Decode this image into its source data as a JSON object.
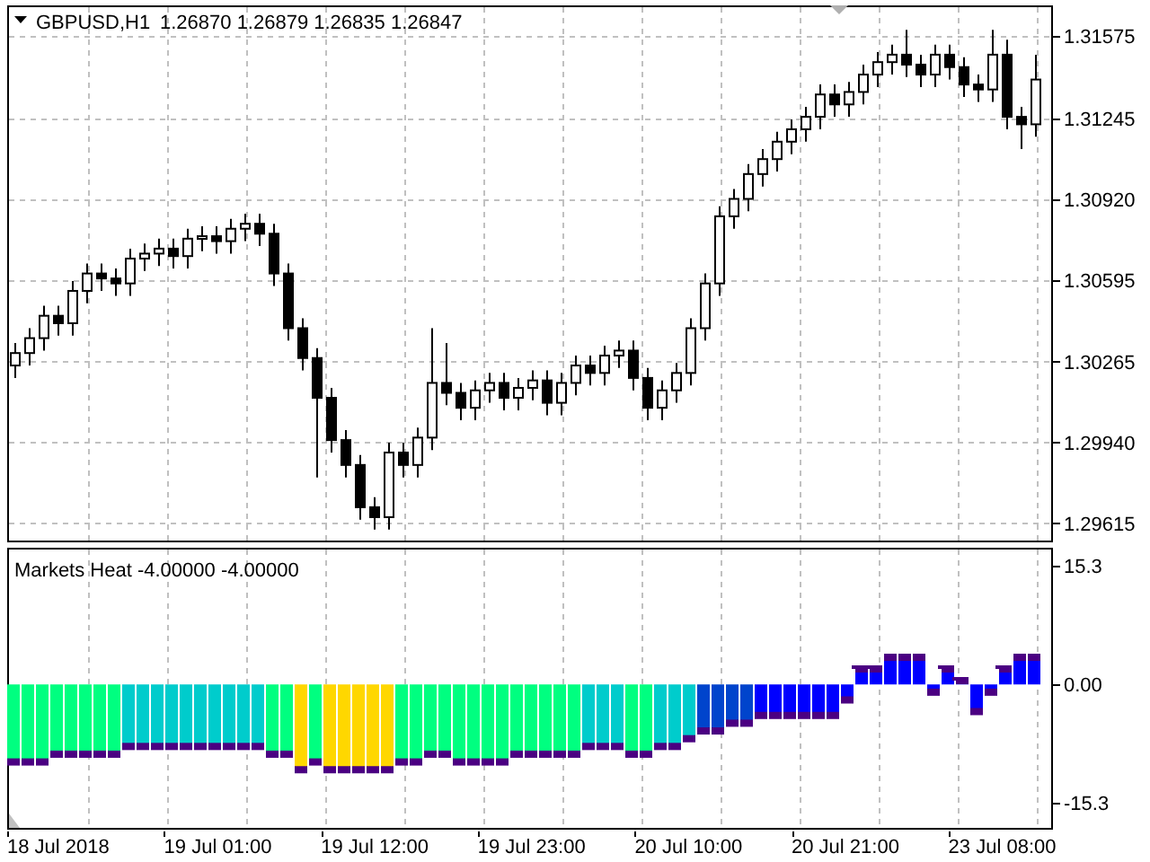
{
  "chart": {
    "symbol": "GBPUSD,H1",
    "quotes": "1.26870 1.26879 1.26835 1.26847",
    "chart_data": {
      "type": "candlestick",
      "grid": true,
      "categories": [
        null,
        null,
        null,
        null,
        null,
        null,
        null,
        null,
        null,
        null,
        null,
        null,
        null,
        null,
        null,
        null,
        null,
        null,
        null,
        null,
        null,
        null,
        null,
        null,
        null,
        null,
        null,
        null,
        null,
        null,
        null,
        null,
        null,
        null,
        null,
        null,
        null,
        null,
        null,
        null,
        null,
        null,
        null,
        null,
        null,
        null,
        null,
        null,
        null,
        null,
        null,
        null,
        null,
        null,
        null,
        null,
        null,
        null,
        null,
        null,
        null,
        null,
        null,
        null,
        null,
        null,
        null,
        null,
        null,
        null,
        null,
        null
      ],
      "ohlc": [
        [
          1.3025,
          1.3034,
          1.302,
          1.303
        ],
        [
          1.303,
          1.304,
          1.3025,
          1.3036
        ],
        [
          1.3036,
          1.3049,
          1.3031,
          1.3045
        ],
        [
          1.3045,
          1.3049,
          1.3037,
          1.3042
        ],
        [
          1.3042,
          1.3059,
          1.3037,
          1.3055
        ],
        [
          1.3055,
          1.3066,
          1.305,
          1.3062
        ],
        [
          1.3062,
          1.3066,
          1.3055,
          1.306
        ],
        [
          1.306,
          1.3064,
          1.3053,
          1.3058
        ],
        [
          1.3058,
          1.3072,
          1.3053,
          1.3068
        ],
        [
          1.3068,
          1.3074,
          1.3063,
          1.307
        ],
        [
          1.307,
          1.3076,
          1.3065,
          1.3072
        ],
        [
          1.3072,
          1.3076,
          1.3064,
          1.3069
        ],
        [
          1.3069,
          1.308,
          1.3064,
          1.3076
        ],
        [
          1.3076,
          1.3081,
          1.3071,
          1.3077
        ],
        [
          1.3077,
          1.3081,
          1.307,
          1.3075
        ],
        [
          1.3075,
          1.3084,
          1.307,
          1.308
        ],
        [
          1.308,
          1.3086,
          1.3075,
          1.3082
        ],
        [
          1.3082,
          1.3086,
          1.3073,
          1.3078
        ],
        [
          1.3078,
          1.3082,
          1.3057,
          1.3062
        ],
        [
          1.3062,
          1.3066,
          1.3035,
          1.304
        ],
        [
          1.304,
          1.3044,
          1.3023,
          1.3028
        ],
        [
          1.3028,
          1.3032,
          1.298,
          1.3012
        ],
        [
          1.3012,
          1.3016,
          1.299,
          1.2995
        ],
        [
          1.2995,
          1.2999,
          1.298,
          1.2985
        ],
        [
          1.2985,
          1.2989,
          1.2963,
          1.2968
        ],
        [
          1.2968,
          1.2972,
          1.2959,
          1.2964
        ],
        [
          1.2964,
          1.2994,
          1.2959,
          1.299
        ],
        [
          1.299,
          1.2994,
          1.298,
          1.2985
        ],
        [
          1.2985,
          1.3,
          1.298,
          1.2996
        ],
        [
          1.2996,
          1.304,
          1.2991,
          1.3018
        ],
        [
          1.3018,
          1.3034,
          1.3009,
          1.3014
        ],
        [
          1.3014,
          1.3018,
          1.3003,
          1.3008
        ],
        [
          1.3008,
          1.3019,
          1.3003,
          1.3015
        ],
        [
          1.3015,
          1.3022,
          1.301,
          1.3018
        ],
        [
          1.3018,
          1.3022,
          1.3007,
          1.3012
        ],
        [
          1.3012,
          1.302,
          1.3007,
          1.3016
        ],
        [
          1.3016,
          1.3023,
          1.3011,
          1.3019
        ],
        [
          1.3019,
          1.3023,
          1.3005,
          1.301
        ],
        [
          1.301,
          1.3022,
          1.3005,
          1.3018
        ],
        [
          1.3018,
          1.3029,
          1.3013,
          1.3025
        ],
        [
          1.3025,
          1.3029,
          1.3017,
          1.3022
        ],
        [
          1.3022,
          1.3033,
          1.3017,
          1.3029
        ],
        [
          1.3029,
          1.3035,
          1.3024,
          1.3031
        ],
        [
          1.3031,
          1.3035,
          1.3015,
          1.302
        ],
        [
          1.302,
          1.3024,
          1.3003,
          1.3008
        ],
        [
          1.3008,
          1.3019,
          1.3003,
          1.3015
        ],
        [
          1.3015,
          1.3026,
          1.301,
          1.3022
        ],
        [
          1.3022,
          1.3044,
          1.3017,
          1.304
        ],
        [
          1.304,
          1.3062,
          1.3035,
          1.3058
        ],
        [
          1.3058,
          1.3089,
          1.3053,
          1.3085
        ],
        [
          1.3085,
          1.3096,
          1.308,
          1.3092
        ],
        [
          1.3092,
          1.3106,
          1.3087,
          1.3102
        ],
        [
          1.3102,
          1.3112,
          1.3097,
          1.3108
        ],
        [
          1.3108,
          1.3119,
          1.3103,
          1.3115
        ],
        [
          1.3115,
          1.3124,
          1.311,
          1.312
        ],
        [
          1.312,
          1.3129,
          1.3115,
          1.3125
        ],
        [
          1.3125,
          1.3138,
          1.312,
          1.3134
        ],
        [
          1.3134,
          1.3138,
          1.3125,
          1.313
        ],
        [
          1.313,
          1.3139,
          1.3125,
          1.3135
        ],
        [
          1.3135,
          1.3146,
          1.313,
          1.3142
        ],
        [
          1.3142,
          1.3151,
          1.3137,
          1.3147
        ],
        [
          1.3147,
          1.3154,
          1.3142,
          1.315
        ],
        [
          1.315,
          1.316,
          1.3141,
          1.3146
        ],
        [
          1.3146,
          1.315,
          1.3137,
          1.3142
        ],
        [
          1.3142,
          1.3154,
          1.3137,
          1.315
        ],
        [
          1.315,
          1.3154,
          1.314,
          1.3145
        ],
        [
          1.3145,
          1.3149,
          1.3133,
          1.3138
        ],
        [
          1.3138,
          1.3142,
          1.3131,
          1.3136
        ],
        [
          1.3136,
          1.316,
          1.3131,
          1.315
        ],
        [
          1.315,
          1.3156,
          1.312,
          1.3125
        ],
        [
          1.3125,
          1.3129,
          1.3112,
          1.3122
        ],
        [
          1.3122,
          1.315,
          1.3117,
          1.314
        ]
      ],
      "ylim": [
        1.29546,
        1.31691
      ],
      "yticks": [
        {
          "value": 1.31575,
          "label": "1.31575"
        },
        {
          "value": 1.31245,
          "label": "1.31245"
        },
        {
          "value": 1.3092,
          "label": "1.30920"
        },
        {
          "value": 1.30595,
          "label": "1.30595"
        },
        {
          "value": 1.30265,
          "label": "1.30265"
        },
        {
          "value": 1.2994,
          "label": "1.29940"
        },
        {
          "value": 1.29615,
          "label": "1.29615"
        }
      ]
    }
  },
  "indicator": {
    "title": "Markets Heat -4.00000 -4.00000",
    "chart_data": {
      "type": "bar",
      "grid": true,
      "categories": [
        null,
        null,
        null,
        null,
        null,
        null,
        null,
        null,
        null,
        null,
        null,
        null,
        null,
        null,
        null,
        null,
        null,
        null,
        null,
        null,
        null,
        null,
        null,
        null,
        null,
        null,
        null,
        null,
        null,
        null,
        null,
        null,
        null,
        null,
        null,
        null,
        null,
        null,
        null,
        null,
        null,
        null,
        null,
        null,
        null,
        null,
        null,
        null,
        null,
        null,
        null,
        null,
        null,
        null,
        null,
        null,
        null,
        null,
        null,
        null,
        null,
        null,
        null,
        null,
        null,
        null,
        null,
        null,
        null,
        null,
        null,
        null
      ],
      "series": [
        {
          "color": "#00ff80",
          "values": [
            -10,
            -10,
            -10,
            -9,
            -9,
            -9,
            -9,
            -9,
            null,
            null,
            null,
            null,
            null,
            null,
            null,
            null,
            null,
            null,
            -9,
            -9,
            null,
            -10,
            null,
            null,
            null,
            null,
            null,
            -10,
            -10,
            -9,
            -9,
            -10,
            -10,
            -10,
            -10,
            -9,
            -9,
            -9,
            -9,
            -9,
            null,
            null,
            null,
            -9,
            -9,
            null,
            null,
            null,
            null,
            null,
            null,
            null,
            null,
            null,
            null,
            null,
            null,
            null,
            null,
            null,
            null,
            null,
            null,
            null,
            null,
            null,
            null,
            null,
            null,
            null,
            null,
            null
          ]
        },
        {
          "color": "#00cccc",
          "values": [
            null,
            null,
            null,
            null,
            null,
            null,
            null,
            null,
            -8,
            -8,
            -8,
            -8,
            -8,
            -8,
            -8,
            -8,
            -8,
            -8,
            null,
            null,
            null,
            null,
            null,
            null,
            null,
            null,
            null,
            null,
            null,
            null,
            null,
            null,
            null,
            null,
            null,
            null,
            null,
            null,
            null,
            null,
            -8,
            -8,
            -8,
            null,
            null,
            -8,
            -8,
            -7,
            null,
            null,
            null,
            null,
            null,
            null,
            null,
            null,
            null,
            null,
            null,
            null,
            null,
            null,
            null,
            null,
            null,
            null,
            null,
            null,
            null,
            null,
            null,
            null
          ]
        },
        {
          "color": "#ffd700",
          "values": [
            null,
            null,
            null,
            null,
            null,
            null,
            null,
            null,
            null,
            null,
            null,
            null,
            null,
            null,
            null,
            null,
            null,
            null,
            null,
            null,
            -11,
            null,
            -11,
            -11,
            -11,
            -11,
            -11,
            null,
            null,
            null,
            null,
            null,
            null,
            null,
            null,
            null,
            null,
            null,
            null,
            null,
            null,
            null,
            null,
            null,
            null,
            null,
            null,
            null,
            null,
            null,
            null,
            null,
            null,
            null,
            null,
            null,
            null,
            null,
            null,
            null,
            null,
            null,
            null,
            null,
            null,
            null,
            null,
            null,
            null,
            null,
            null,
            null
          ]
        },
        {
          "color": "#0044cc",
          "values": [
            null,
            null,
            null,
            null,
            null,
            null,
            null,
            null,
            null,
            null,
            null,
            null,
            null,
            null,
            null,
            null,
            null,
            null,
            null,
            null,
            null,
            null,
            null,
            null,
            null,
            null,
            null,
            null,
            null,
            null,
            null,
            null,
            null,
            null,
            null,
            null,
            null,
            null,
            null,
            null,
            null,
            null,
            null,
            null,
            null,
            null,
            null,
            null,
            -6,
            -6,
            -5,
            -5,
            null,
            null,
            null,
            null,
            null,
            null,
            null,
            null,
            null,
            null,
            null,
            null,
            null,
            null,
            null,
            null,
            null,
            null,
            null,
            null
          ]
        },
        {
          "color": "#0000ff",
          "values": [
            null,
            null,
            null,
            null,
            null,
            null,
            null,
            null,
            null,
            null,
            null,
            null,
            null,
            null,
            null,
            null,
            null,
            null,
            null,
            null,
            null,
            null,
            null,
            null,
            null,
            null,
            null,
            null,
            null,
            null,
            null,
            null,
            null,
            null,
            null,
            null,
            null,
            null,
            null,
            null,
            null,
            null,
            null,
            null,
            null,
            null,
            null,
            null,
            null,
            null,
            null,
            null,
            -4,
            -4,
            -4,
            -4,
            -4,
            -4,
            -2,
            2,
            2,
            3.5,
            3.5,
            3.5,
            -1,
            2,
            0.5,
            -3.5,
            -1,
            2,
            3.5,
            3.5
          ]
        }
      ],
      "ylim": [
        -18.5,
        17.4
      ],
      "yticks": [
        {
          "value": 15.3,
          "label": "15.3"
        },
        {
          "value": 0,
          "label": "0.00"
        },
        {
          "value": -15.3,
          "label": "-15.3"
        }
      ]
    }
  },
  "time_axis": [
    "18 Jul 2018",
    "19 Jul 01:00",
    "19 Jul 12:00",
    "19 Jul 23:00",
    "20 Jul 10:00",
    "20 Jul 21:00",
    "23 Jul 08:00"
  ]
}
